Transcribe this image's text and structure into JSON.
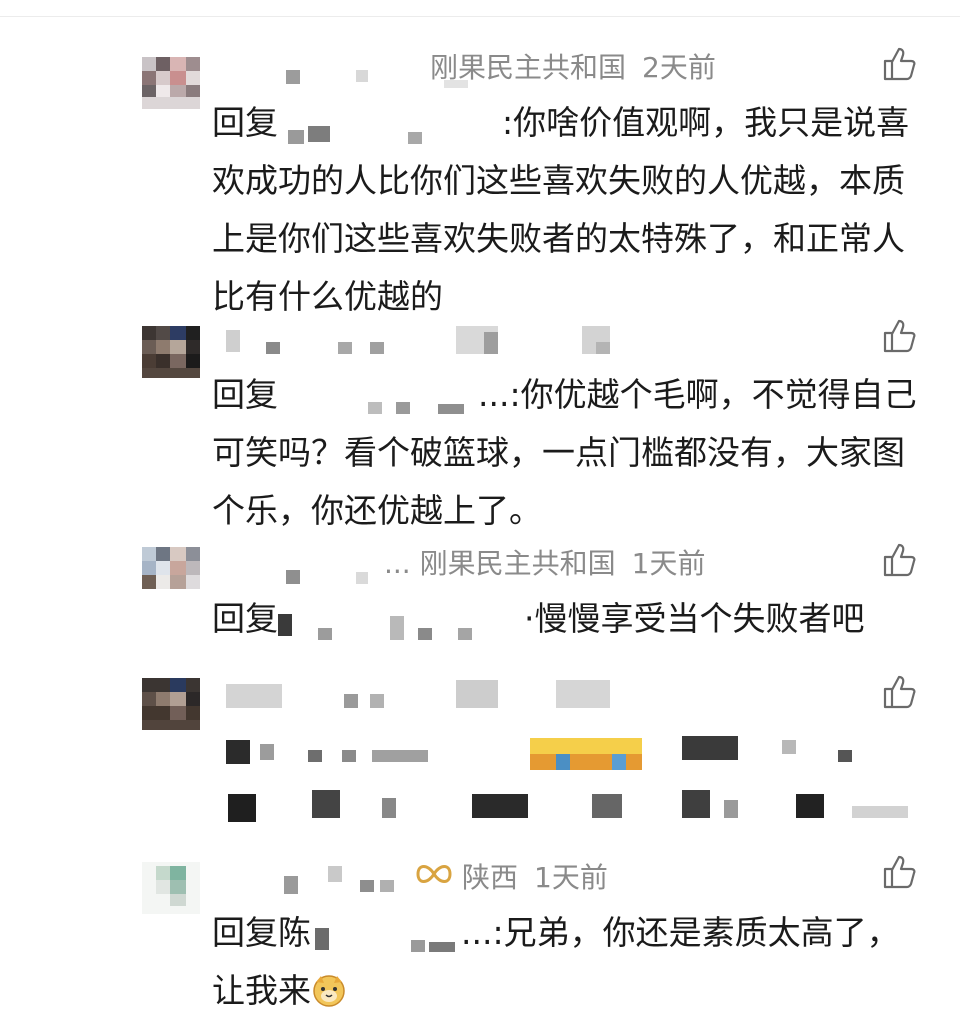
{
  "comments": [
    {
      "location": "刚果民主共和国",
      "time": "2天前",
      "reply_prefix": "回复",
      "reply_sep": ":",
      "text": "你啥价值观啊，我只是说喜欢成功的人比你们这些喜欢失败的人优越，本质上是你们这些喜欢失败者的太特殊了，和正常人比有什么优越的"
    },
    {
      "reply_prefix": "回复",
      "reply_sep": "...:",
      "text": "你优越个毛啊，不觉得自己可笑吗？看个破篮球，一点门槛都没有，大家图个乐，你还优越上了。"
    },
    {
      "ellipsis": "...",
      "location": "刚果民主共和国",
      "time": "1天前",
      "reply_prefix": "回复",
      "reply_sep": "·",
      "text": "慢慢享受当个失败者吧"
    },
    {
      "text": ""
    },
    {
      "location": "陕西",
      "time": "1天前",
      "reply_prefix": "回复陈",
      "reply_sep": "...:",
      "text": "兄弟，你还是素质太高了，让我来"
    }
  ],
  "icons": {
    "like": "thumbs-up-outline-icon",
    "emoji": "doge-emoji-icon",
    "badge": "infinity-badge-icon"
  },
  "colors": {
    "meta_text": "#8a8a8a",
    "body_text": "#1b1b1b",
    "badge": "#d9a441"
  }
}
